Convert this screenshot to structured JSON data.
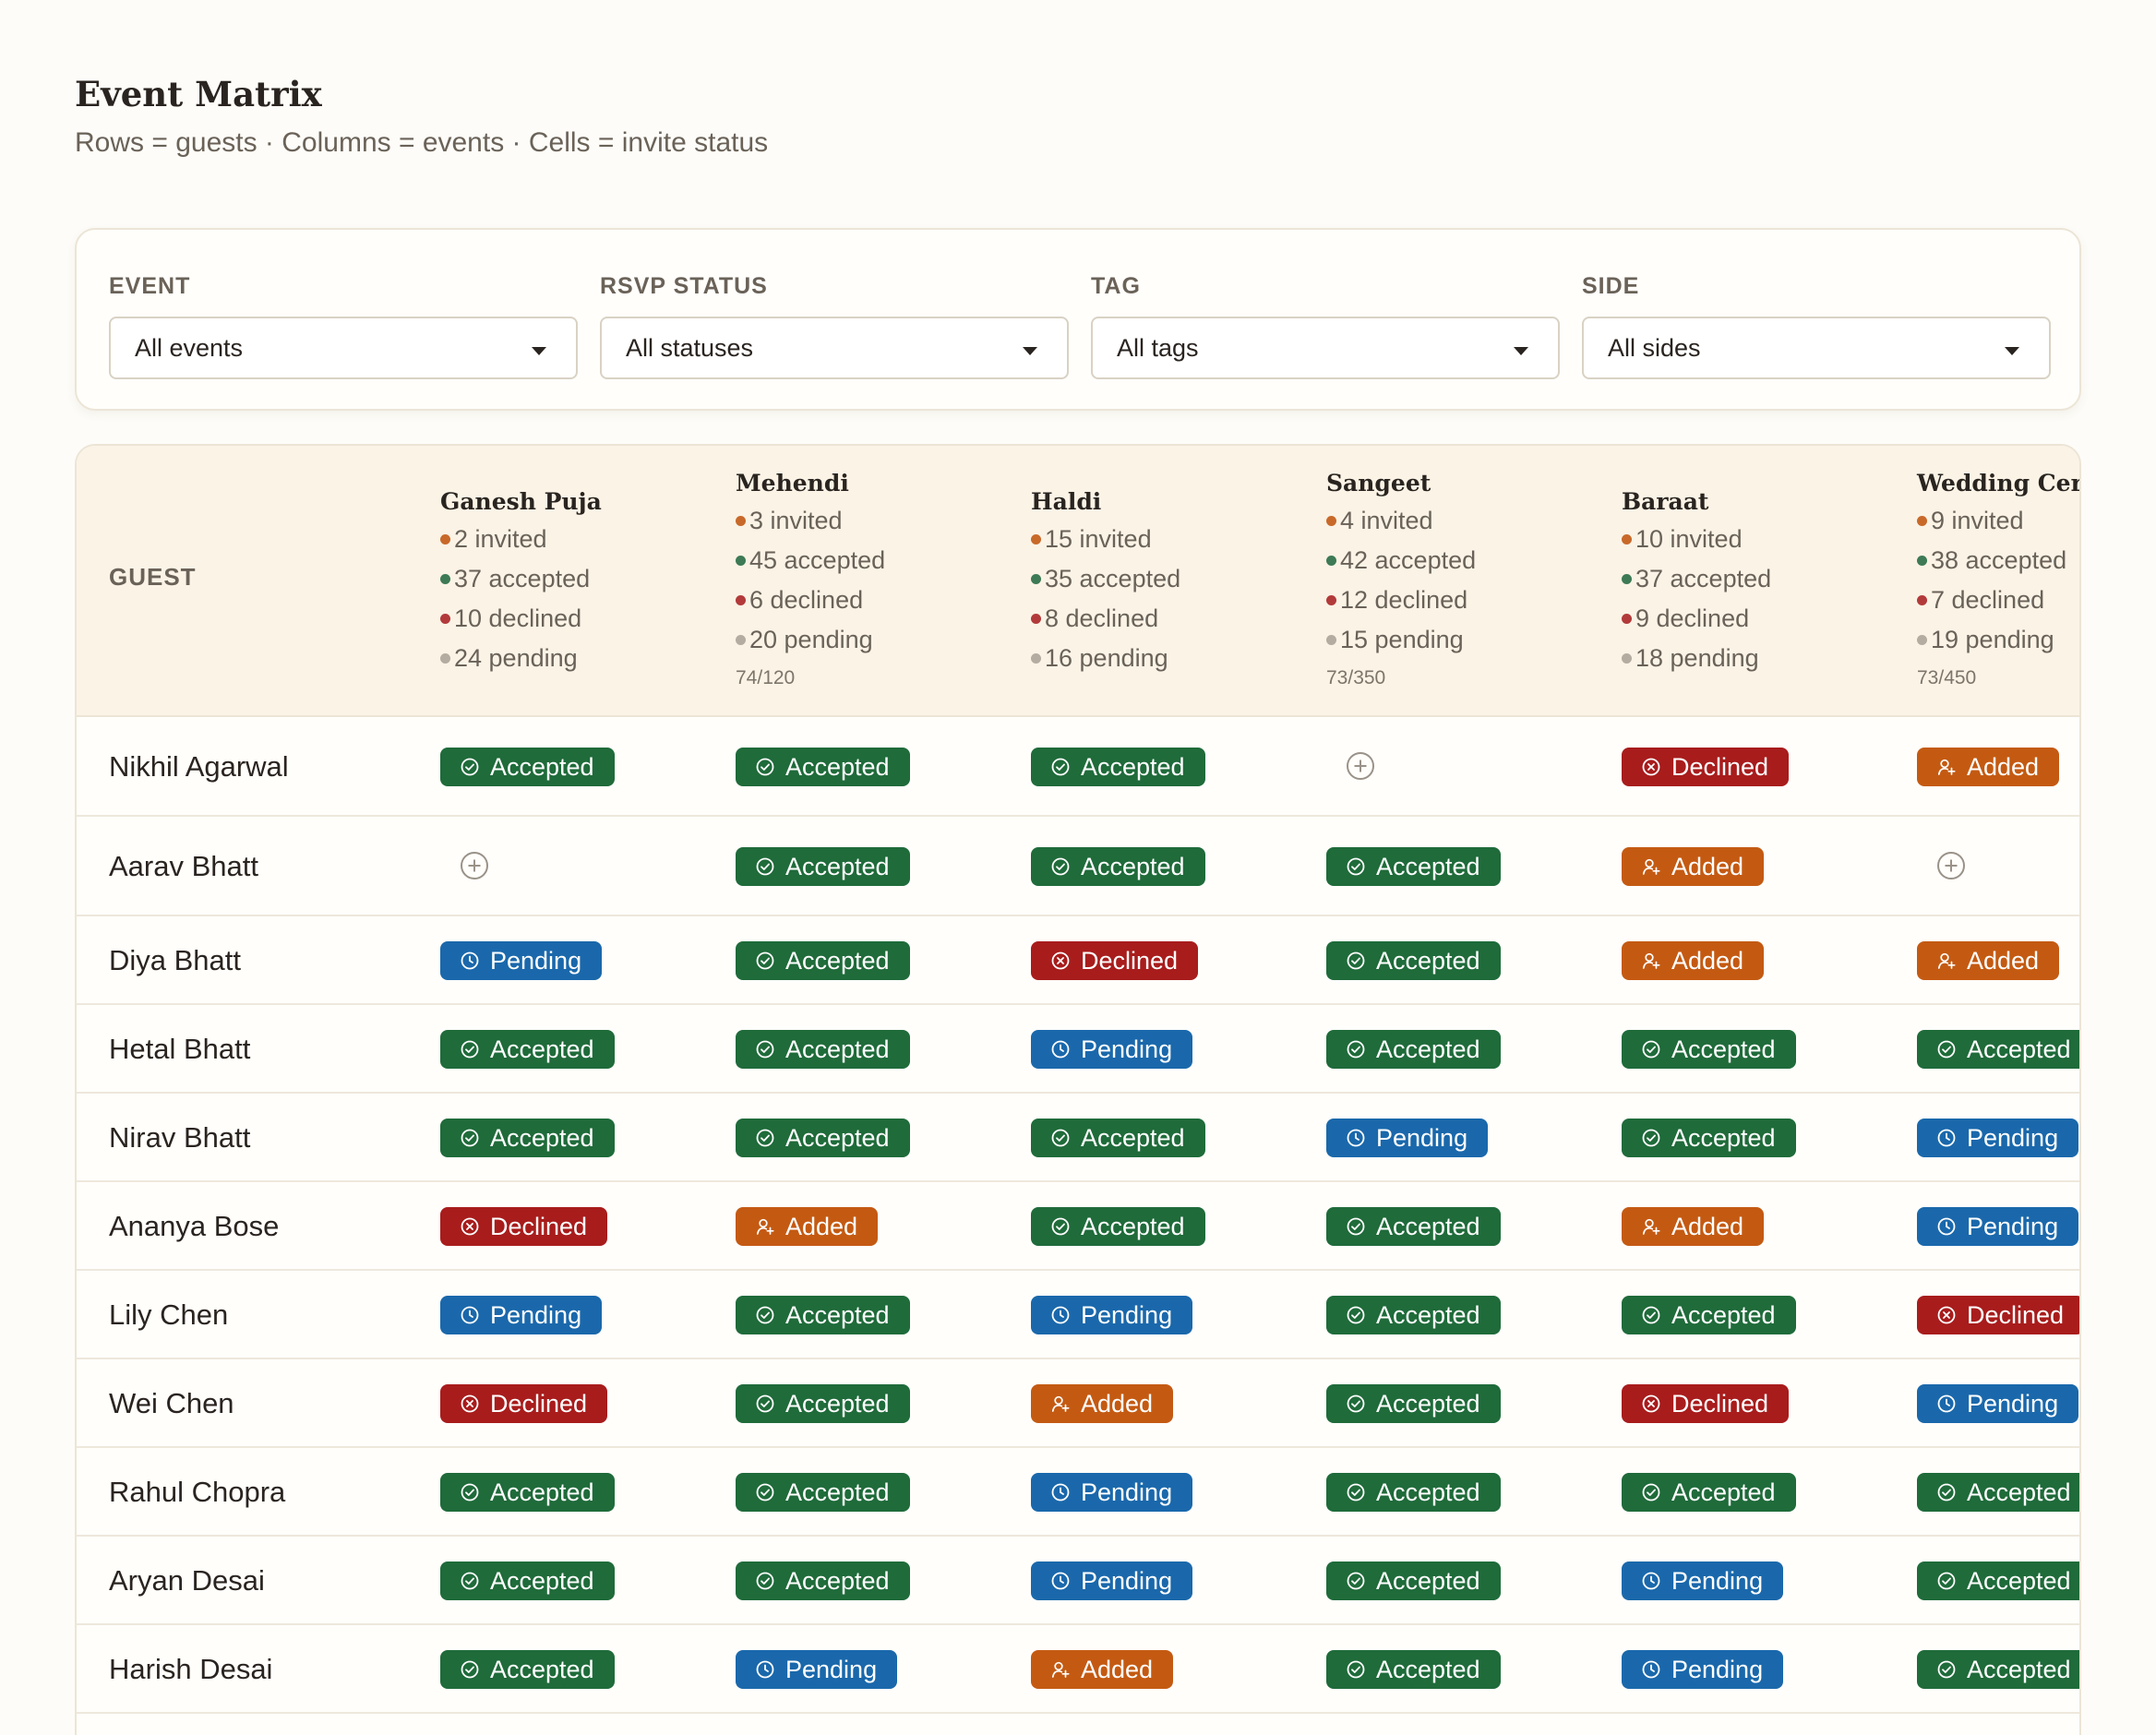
{
  "header": {
    "title": "Event Matrix",
    "subtitle": "Rows = guests · Columns = events · Cells = invite status"
  },
  "filters": [
    {
      "label": "EVENT",
      "value": "All events"
    },
    {
      "label": "RSVP STATUS",
      "value": "All statuses"
    },
    {
      "label": "TAG",
      "value": "All tags"
    },
    {
      "label": "SIDE",
      "value": "All sides"
    }
  ],
  "matrix": {
    "guest_header": "GUEST",
    "events": [
      {
        "name": "Ganesh Puja",
        "invited": "2 invited",
        "accepted": "37 accepted",
        "declined": "10 declined",
        "pending": "24 pending",
        "ratio": ""
      },
      {
        "name": "Mehendi",
        "invited": "3 invited",
        "accepted": "45 accepted",
        "declined": "6 declined",
        "pending": "20 pending",
        "ratio": "74/120"
      },
      {
        "name": "Haldi",
        "invited": "15 invited",
        "accepted": "35 accepted",
        "declined": "8 declined",
        "pending": "16 pending",
        "ratio": ""
      },
      {
        "name": "Sangeet",
        "invited": "4 invited",
        "accepted": "42 accepted",
        "declined": "12 declined",
        "pending": "15 pending",
        "ratio": "73/350"
      },
      {
        "name": "Baraat",
        "invited": "10 invited",
        "accepted": "37 accepted",
        "declined": "9 declined",
        "pending": "18 pending",
        "ratio": ""
      },
      {
        "name": "Wedding Ceremony",
        "invited": "9 invited",
        "accepted": "38 accepted",
        "declined": "7 declined",
        "pending": "19 pending",
        "ratio": "73/450"
      }
    ],
    "status_labels": {
      "accepted": "Accepted",
      "pending": "Pending",
      "declined": "Declined",
      "added": "Added"
    },
    "status_colors": {
      "accepted": "#1f6b3a",
      "pending": "#1a68ab",
      "declined": "#a81c1c",
      "added": "#c45a12"
    },
    "icons": {
      "accepted": "check-circle-icon",
      "pending": "clock-icon",
      "declined": "x-circle-icon",
      "added": "person-add-icon",
      "empty": "plus-circle-icon"
    },
    "guests": [
      {
        "name": "Nikhil Agarwal",
        "cells": [
          "accepted",
          "accepted",
          "accepted",
          "empty",
          "declined",
          "added"
        ]
      },
      {
        "name": "Aarav Bhatt",
        "cells": [
          "empty",
          "accepted",
          "accepted",
          "accepted",
          "added",
          "empty"
        ]
      },
      {
        "name": "Diya Bhatt",
        "cells": [
          "pending",
          "accepted",
          "declined",
          "accepted",
          "added",
          "added"
        ]
      },
      {
        "name": "Hetal Bhatt",
        "cells": [
          "accepted",
          "accepted",
          "pending",
          "accepted",
          "accepted",
          "accepted"
        ]
      },
      {
        "name": "Nirav Bhatt",
        "cells": [
          "accepted",
          "accepted",
          "accepted",
          "pending",
          "accepted",
          "pending"
        ]
      },
      {
        "name": "Ananya Bose",
        "cells": [
          "declined",
          "added",
          "accepted",
          "accepted",
          "added",
          "pending"
        ]
      },
      {
        "name": "Lily Chen",
        "cells": [
          "pending",
          "accepted",
          "pending",
          "accepted",
          "accepted",
          "declined"
        ]
      },
      {
        "name": "Wei Chen",
        "cells": [
          "declined",
          "accepted",
          "added",
          "accepted",
          "declined",
          "pending"
        ]
      },
      {
        "name": "Rahul Chopra",
        "cells": [
          "accepted",
          "accepted",
          "pending",
          "accepted",
          "accepted",
          "accepted"
        ]
      },
      {
        "name": "Aryan Desai",
        "cells": [
          "accepted",
          "accepted",
          "pending",
          "accepted",
          "pending",
          "accepted"
        ]
      },
      {
        "name": "Harish Desai",
        "cells": [
          "accepted",
          "pending",
          "added",
          "accepted",
          "pending",
          "accepted"
        ]
      }
    ]
  }
}
